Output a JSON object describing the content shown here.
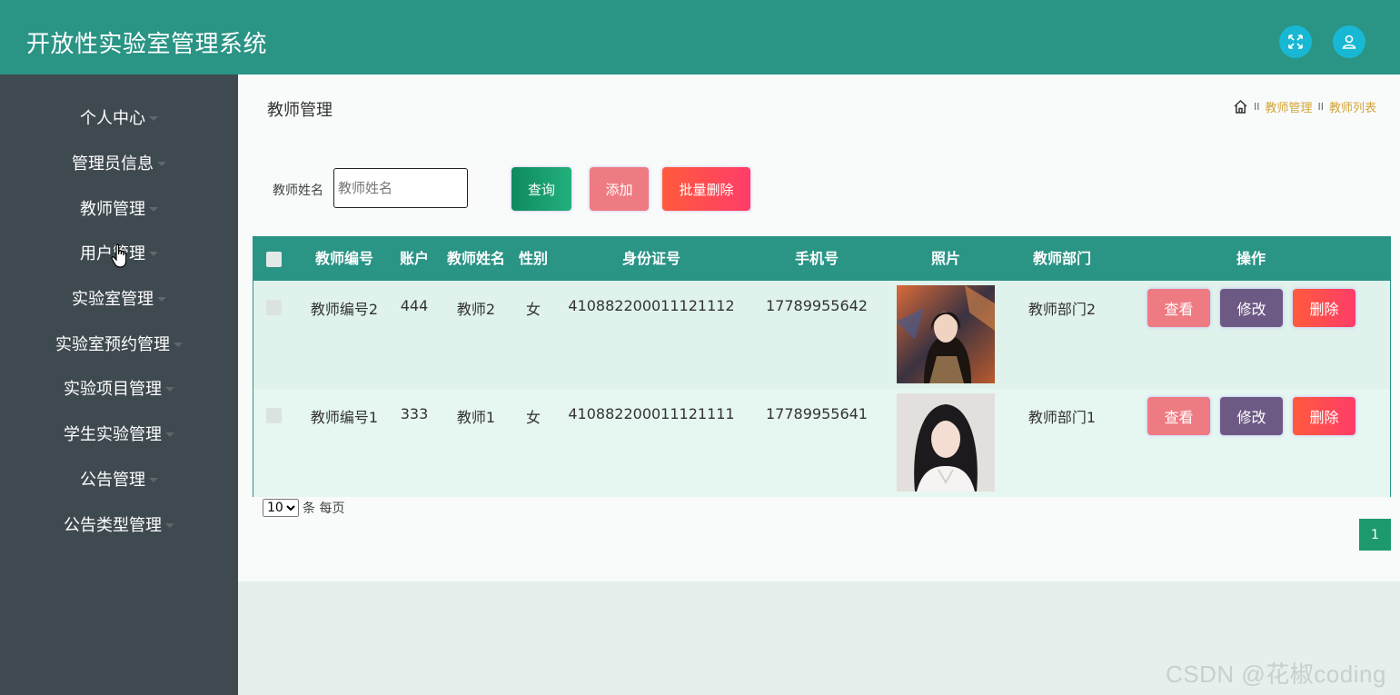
{
  "app": {
    "title": "开放性实验室管理系统",
    "header_icons": [
      "fullscreen-icon",
      "user-icon"
    ]
  },
  "sidebar": {
    "items": [
      {
        "label": "个人中心"
      },
      {
        "label": "管理员信息"
      },
      {
        "label": "教师管理"
      },
      {
        "label": "用户管理"
      },
      {
        "label": "实验室管理"
      },
      {
        "label": "实验室预约管理"
      },
      {
        "label": "实验项目管理"
      },
      {
        "label": "学生实验管理"
      },
      {
        "label": "公告管理"
      },
      {
        "label": "公告类型管理"
      }
    ]
  },
  "page": {
    "title": "教师管理",
    "breadcrumb": [
      "教师管理",
      "教师列表"
    ],
    "breadcrumb_sep": "II"
  },
  "search": {
    "label": "教师姓名",
    "placeholder": "教师姓名",
    "value": ""
  },
  "toolbar": {
    "query_label": "查询",
    "add_label": "添加",
    "batch_delete_label": "批量删除"
  },
  "table": {
    "columns": [
      "教师编号",
      "账户",
      "教师姓名",
      "性别",
      "身份证号",
      "手机号",
      "照片",
      "教师部门",
      "操作"
    ],
    "rows": [
      {
        "id": "教师编号2",
        "account": "444",
        "name": "教师2",
        "gender": "女",
        "id_card": "410882200011121112",
        "phone": "17789955642",
        "dept": "教师部门2"
      },
      {
        "id": "教师编号1",
        "account": "333",
        "name": "教师1",
        "gender": "女",
        "id_card": "410882200011121111",
        "phone": "17789955641",
        "dept": "教师部门1"
      }
    ],
    "actions": {
      "view": "查看",
      "edit": "修改",
      "delete": "删除"
    }
  },
  "pagination": {
    "page_size": "10",
    "page_size_suffix": "条 每页",
    "current_page": "1"
  },
  "watermark": "CSDN @花椒coding",
  "colors": {
    "header": "#2a9485",
    "sidebar": "#3f4a50",
    "view_button": "#ee7b82",
    "edit_button": "#6d5a84",
    "delete_button": "#ff4a55",
    "query_button": "#1a9a6a"
  }
}
